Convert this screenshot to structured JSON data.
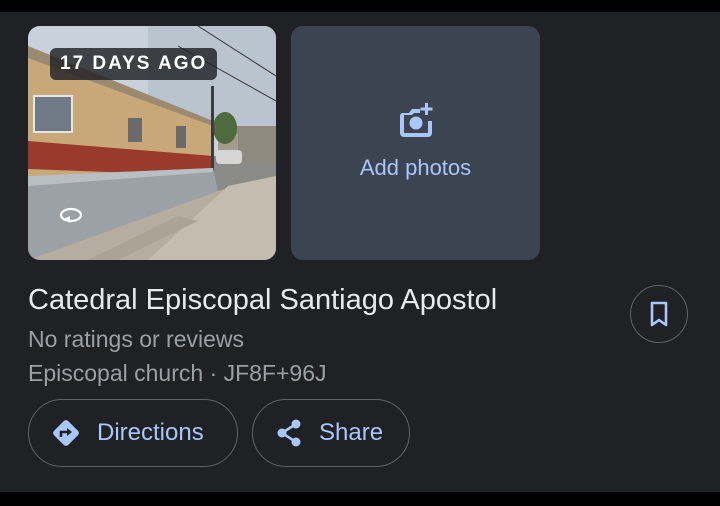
{
  "photo": {
    "age_badge": "17 DAYS AGO",
    "icon": "rotate-360-icon"
  },
  "add_photos": {
    "label": "Add photos",
    "icon": "add-photo-camera-icon"
  },
  "place": {
    "name": "Catedral Episcopal Santiago Apostol",
    "ratings": "No ratings or reviews",
    "category_code": "Episcopal church · JF8F+96J"
  },
  "actions": {
    "directions_label": "Directions",
    "directions_icon": "directions-diamond-icon",
    "share_label": "Share",
    "share_icon": "share-icon",
    "save_icon": "bookmark-icon"
  },
  "colors": {
    "background": "#202124",
    "accent": "#a8c7fa",
    "text_primary": "#e8eaed",
    "text_secondary": "#9aa0a6",
    "tile": "#3c4452",
    "outline": "#5f6368"
  }
}
